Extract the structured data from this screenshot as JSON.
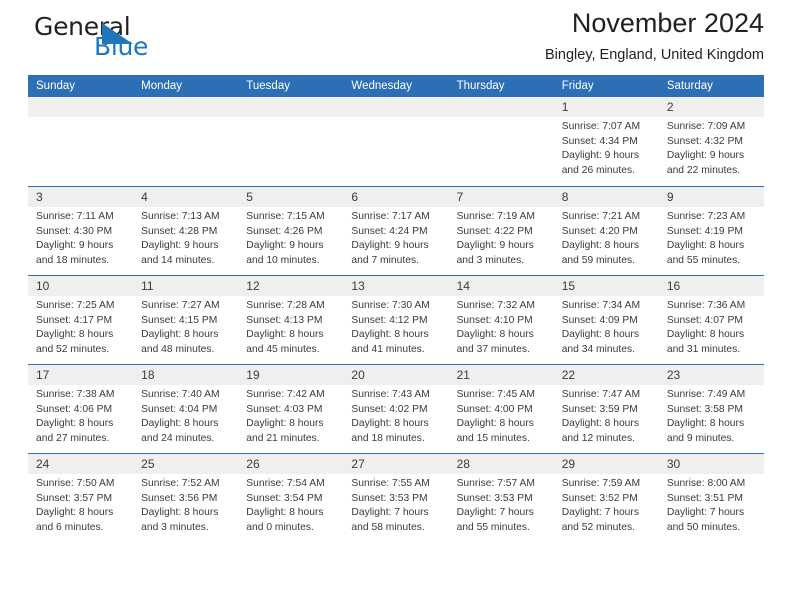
{
  "brand": {
    "word_one": "General",
    "word_two": "Blue",
    "triangle_color": "#2076bc",
    "text_color": "#231f20"
  },
  "header": {
    "title": "November 2024",
    "subtitle": "Bingley, England, United Kingdom"
  },
  "theme": {
    "header_blue": "#2d6fb5",
    "day_band_gray": "#efefef",
    "text": "#3b3b3b",
    "white": "#ffffff"
  },
  "calendar": {
    "weekdays": [
      "Sunday",
      "Monday",
      "Tuesday",
      "Wednesday",
      "Thursday",
      "Friday",
      "Saturday"
    ],
    "weeks": [
      [
        {
          "day": "",
          "lines": []
        },
        {
          "day": "",
          "lines": []
        },
        {
          "day": "",
          "lines": []
        },
        {
          "day": "",
          "lines": []
        },
        {
          "day": "",
          "lines": []
        },
        {
          "day": "1",
          "lines": [
            "Sunrise: 7:07 AM",
            "Sunset: 4:34 PM",
            "Daylight: 9 hours",
            "and 26 minutes."
          ]
        },
        {
          "day": "2",
          "lines": [
            "Sunrise: 7:09 AM",
            "Sunset: 4:32 PM",
            "Daylight: 9 hours",
            "and 22 minutes."
          ]
        }
      ],
      [
        {
          "day": "3",
          "lines": [
            "Sunrise: 7:11 AM",
            "Sunset: 4:30 PM",
            "Daylight: 9 hours",
            "and 18 minutes."
          ]
        },
        {
          "day": "4",
          "lines": [
            "Sunrise: 7:13 AM",
            "Sunset: 4:28 PM",
            "Daylight: 9 hours",
            "and 14 minutes."
          ]
        },
        {
          "day": "5",
          "lines": [
            "Sunrise: 7:15 AM",
            "Sunset: 4:26 PM",
            "Daylight: 9 hours",
            "and 10 minutes."
          ]
        },
        {
          "day": "6",
          "lines": [
            "Sunrise: 7:17 AM",
            "Sunset: 4:24 PM",
            "Daylight: 9 hours",
            "and 7 minutes."
          ]
        },
        {
          "day": "7",
          "lines": [
            "Sunrise: 7:19 AM",
            "Sunset: 4:22 PM",
            "Daylight: 9 hours",
            "and 3 minutes."
          ]
        },
        {
          "day": "8",
          "lines": [
            "Sunrise: 7:21 AM",
            "Sunset: 4:20 PM",
            "Daylight: 8 hours",
            "and 59 minutes."
          ]
        },
        {
          "day": "9",
          "lines": [
            "Sunrise: 7:23 AM",
            "Sunset: 4:19 PM",
            "Daylight: 8 hours",
            "and 55 minutes."
          ]
        }
      ],
      [
        {
          "day": "10",
          "lines": [
            "Sunrise: 7:25 AM",
            "Sunset: 4:17 PM",
            "Daylight: 8 hours",
            "and 52 minutes."
          ]
        },
        {
          "day": "11",
          "lines": [
            "Sunrise: 7:27 AM",
            "Sunset: 4:15 PM",
            "Daylight: 8 hours",
            "and 48 minutes."
          ]
        },
        {
          "day": "12",
          "lines": [
            "Sunrise: 7:28 AM",
            "Sunset: 4:13 PM",
            "Daylight: 8 hours",
            "and 45 minutes."
          ]
        },
        {
          "day": "13",
          "lines": [
            "Sunrise: 7:30 AM",
            "Sunset: 4:12 PM",
            "Daylight: 8 hours",
            "and 41 minutes."
          ]
        },
        {
          "day": "14",
          "lines": [
            "Sunrise: 7:32 AM",
            "Sunset: 4:10 PM",
            "Daylight: 8 hours",
            "and 37 minutes."
          ]
        },
        {
          "day": "15",
          "lines": [
            "Sunrise: 7:34 AM",
            "Sunset: 4:09 PM",
            "Daylight: 8 hours",
            "and 34 minutes."
          ]
        },
        {
          "day": "16",
          "lines": [
            "Sunrise: 7:36 AM",
            "Sunset: 4:07 PM",
            "Daylight: 8 hours",
            "and 31 minutes."
          ]
        }
      ],
      [
        {
          "day": "17",
          "lines": [
            "Sunrise: 7:38 AM",
            "Sunset: 4:06 PM",
            "Daylight: 8 hours",
            "and 27 minutes."
          ]
        },
        {
          "day": "18",
          "lines": [
            "Sunrise: 7:40 AM",
            "Sunset: 4:04 PM",
            "Daylight: 8 hours",
            "and 24 minutes."
          ]
        },
        {
          "day": "19",
          "lines": [
            "Sunrise: 7:42 AM",
            "Sunset: 4:03 PM",
            "Daylight: 8 hours",
            "and 21 minutes."
          ]
        },
        {
          "day": "20",
          "lines": [
            "Sunrise: 7:43 AM",
            "Sunset: 4:02 PM",
            "Daylight: 8 hours",
            "and 18 minutes."
          ]
        },
        {
          "day": "21",
          "lines": [
            "Sunrise: 7:45 AM",
            "Sunset: 4:00 PM",
            "Daylight: 8 hours",
            "and 15 minutes."
          ]
        },
        {
          "day": "22",
          "lines": [
            "Sunrise: 7:47 AM",
            "Sunset: 3:59 PM",
            "Daylight: 8 hours",
            "and 12 minutes."
          ]
        },
        {
          "day": "23",
          "lines": [
            "Sunrise: 7:49 AM",
            "Sunset: 3:58 PM",
            "Daylight: 8 hours",
            "and 9 minutes."
          ]
        }
      ],
      [
        {
          "day": "24",
          "lines": [
            "Sunrise: 7:50 AM",
            "Sunset: 3:57 PM",
            "Daylight: 8 hours",
            "and 6 minutes."
          ]
        },
        {
          "day": "25",
          "lines": [
            "Sunrise: 7:52 AM",
            "Sunset: 3:56 PM",
            "Daylight: 8 hours",
            "and 3 minutes."
          ]
        },
        {
          "day": "26",
          "lines": [
            "Sunrise: 7:54 AM",
            "Sunset: 3:54 PM",
            "Daylight: 8 hours",
            "and 0 minutes."
          ]
        },
        {
          "day": "27",
          "lines": [
            "Sunrise: 7:55 AM",
            "Sunset: 3:53 PM",
            "Daylight: 7 hours",
            "and 58 minutes."
          ]
        },
        {
          "day": "28",
          "lines": [
            "Sunrise: 7:57 AM",
            "Sunset: 3:53 PM",
            "Daylight: 7 hours",
            "and 55 minutes."
          ]
        },
        {
          "day": "29",
          "lines": [
            "Sunrise: 7:59 AM",
            "Sunset: 3:52 PM",
            "Daylight: 7 hours",
            "and 52 minutes."
          ]
        },
        {
          "day": "30",
          "lines": [
            "Sunrise: 8:00 AM",
            "Sunset: 3:51 PM",
            "Daylight: 7 hours",
            "and 50 minutes."
          ]
        }
      ]
    ]
  }
}
